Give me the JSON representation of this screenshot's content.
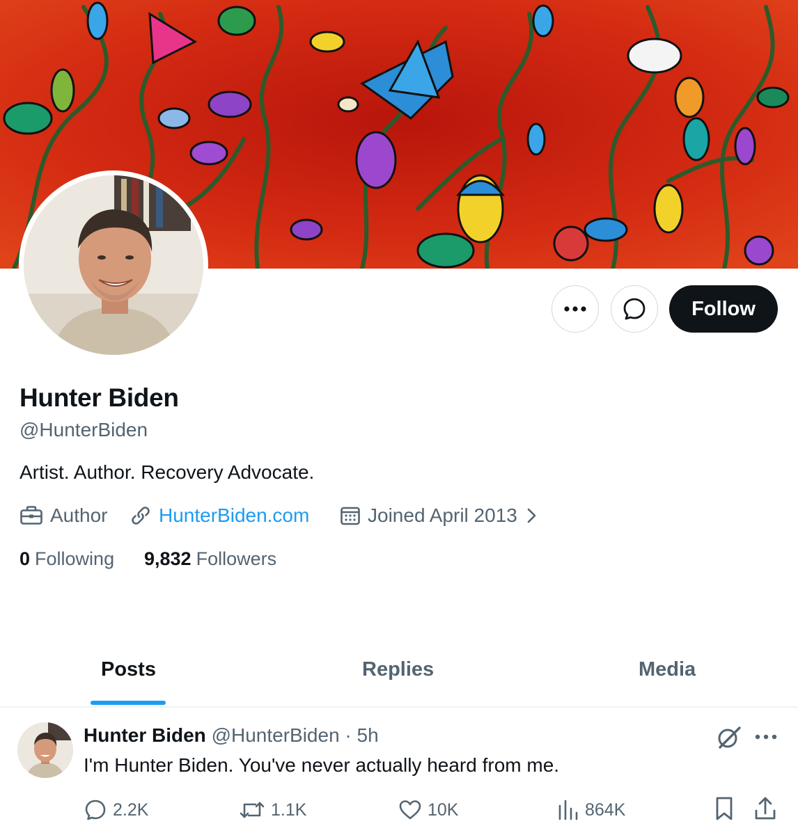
{
  "profile": {
    "name": "Hunter Biden",
    "handle": "@HunterBiden",
    "bio": "Artist. Author. Recovery Advocate.",
    "job": "Author",
    "website": "HunterBiden.com",
    "joined": "Joined April 2013",
    "following_count": "0",
    "following_label": "Following",
    "followers_count": "9,832",
    "followers_label": "Followers"
  },
  "actions": {
    "follow_label": "Follow",
    "more_icon": "more-horizontal-icon",
    "message_icon": "message-bubble-icon"
  },
  "tabs": [
    {
      "label": "Posts",
      "active": true
    },
    {
      "label": "Replies",
      "active": false
    },
    {
      "label": "Media",
      "active": false
    }
  ],
  "post": {
    "author_name": "Hunter Biden",
    "author_handle": "@HunterBiden",
    "time": "· 5h",
    "text": "I'm Hunter Biden. You've never actually heard from me.",
    "replies": "2.2K",
    "reposts": "1.1K",
    "likes": "10K",
    "views": "864K"
  },
  "colors": {
    "accent": "#1d9bf0",
    "text_primary": "#0f1419",
    "text_secondary": "#536471",
    "banner_red": "#c8200f",
    "follow_button": "#0f1419"
  }
}
